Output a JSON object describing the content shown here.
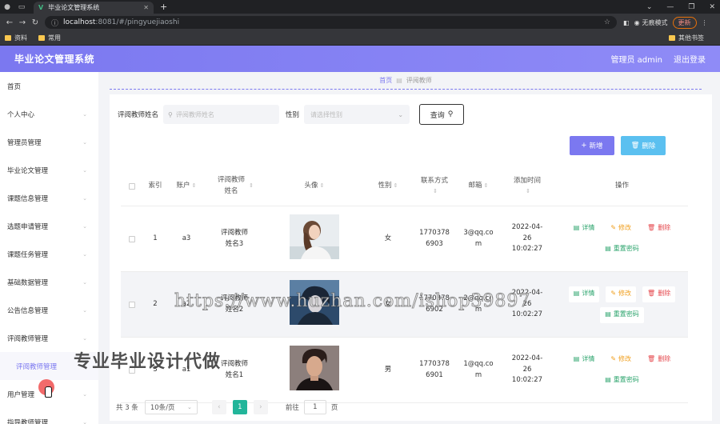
{
  "browser": {
    "tab_title": "毕业论文管理系统",
    "url_host": "localhost",
    "url_path": ":8081/#/pingyuejiaoshi",
    "incognito_label": "无痕模式",
    "update_label": "更新",
    "bookmarks": [
      "资料",
      "常用"
    ],
    "other_bookmarks": "其他书签"
  },
  "header": {
    "title": "毕业论文管理系统",
    "user": "管理员 admin",
    "logout": "退出登录"
  },
  "sidebar": {
    "items": [
      {
        "label": "首页",
        "arrow": false
      },
      {
        "label": "个人中心",
        "arrow": true
      },
      {
        "label": "管理员管理",
        "arrow": true
      },
      {
        "label": "毕业论文管理",
        "arrow": true
      },
      {
        "label": "课题信息管理",
        "arrow": true
      },
      {
        "label": "选题申请管理",
        "arrow": true
      },
      {
        "label": "课题任务管理",
        "arrow": true
      },
      {
        "label": "基础数据管理",
        "arrow": true
      },
      {
        "label": "公告信息管理",
        "arrow": true
      },
      {
        "label": "评阅教师管理",
        "arrow": true
      },
      {
        "label": "评阅教师管理",
        "arrow": false,
        "sub": true
      },
      {
        "label": "用户管理",
        "arrow": true
      },
      {
        "label": "指导教师管理",
        "arrow": true
      }
    ]
  },
  "breadcrumb": {
    "home": "首页",
    "current": "评阅教师"
  },
  "search": {
    "name_label": "评阅教师姓名",
    "name_placeholder": "评阅教师姓名",
    "gender_label": "性别",
    "gender_placeholder": "请选择性别",
    "query_button": "查询"
  },
  "actions": {
    "add": "新增",
    "delete": "删除"
  },
  "table": {
    "headers": {
      "index": "索引",
      "account": "账户",
      "name": "评阅教师姓名",
      "avatar": "头像",
      "gender": "性别",
      "phone": "联系方式",
      "email": "邮箱",
      "time": "添加时间",
      "ops": "操作"
    },
    "rows": [
      {
        "index": "1",
        "account": "a3",
        "name": "评阅教师姓名3",
        "gender": "女",
        "phone": "17703786903",
        "email": "3@qq.com",
        "time": "2022-04-26 10:02:27",
        "avatar_style": "woman"
      },
      {
        "index": "2",
        "account": "a2",
        "name": "评阅教师姓名2",
        "gender": "女",
        "phone": "17703786902",
        "email": "2@qq.com",
        "time": "2022-04-26 10:02:27",
        "avatar_style": "anime"
      },
      {
        "index": "3",
        "account": "a1",
        "name": "评阅教师姓名1",
        "gender": "男",
        "phone": "17703786901",
        "email": "1@qq.com",
        "time": "2022-04-26 10:02:27",
        "avatar_style": "man"
      }
    ],
    "op_labels": {
      "detail": "详情",
      "edit": "修改",
      "remove": "删除",
      "reset": "重置密码"
    }
  },
  "pagination": {
    "total": "共 3 条",
    "page_size": "10条/页",
    "current_page": "1",
    "goto_label": "前往",
    "goto_value": "1",
    "page_suffix": "页"
  },
  "watermarks": {
    "url": "https://www.huzhan.com/ishop39897",
    "slogan": "专业毕业设计代做"
  },
  "colors": {
    "accent": "#7b78f0",
    "info": "#5bc0f0",
    "success": "#2aa36b",
    "warning": "#f0a020",
    "danger": "#e5484d",
    "pager_active": "#22b59a"
  }
}
